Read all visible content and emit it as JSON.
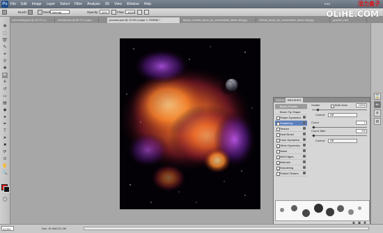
{
  "menubar": {
    "logo": "Ps",
    "items": [
      "File",
      "Edit",
      "Image",
      "Layer",
      "Select",
      "Filter",
      "Analysis",
      "3D",
      "View",
      "Window",
      "Help"
    ],
    "workspace": "ESS",
    "watermark_cn": "活力盒子"
  },
  "options": {
    "brush_label": "Brush:",
    "mode_label": "Mode:",
    "mode_value": "Normal",
    "opacity_label": "Opacity:",
    "opacity_value": "20%",
    "flow_label": "Flow:",
    "flow_value": "100%",
    "watermark": "OLiHE.COM"
  },
  "tabs": [
    {
      "label": "community.psd @ 16.7% (L...",
      "active": false
    },
    {
      "label": "tutorial.psd @ 66.7% (Laye...",
      "active": false
    },
    {
      "label": "process.psd @ 12.5% (Layer 1, RGB/8) *",
      "active": true
    },
    {
      "label": "flaque_nebula_stock_by_moonchilde_stock.d2a.jpg",
      "active": false
    },
    {
      "label": "nebula_stock_by_moonchilde_stock.d3a.jpg",
      "active": false
    },
    {
      "label": "pplanet_neb",
      "active": false
    }
  ],
  "brushes_panel": {
    "tabs": [
      "PATHS",
      "BRUSHES"
    ],
    "rows": [
      {
        "label": "Brush Presets",
        "kind": "header",
        "checked": false
      },
      {
        "label": "Brush Tip Shape",
        "kind": "plain",
        "checked": false
      },
      {
        "label": "Shape Dynamics",
        "kind": "check",
        "checked": false
      },
      {
        "label": "Scattering",
        "kind": "check",
        "checked": true,
        "selected": true
      },
      {
        "label": "Texture",
        "kind": "check",
        "checked": false
      },
      {
        "label": "Dual Brush",
        "kind": "check",
        "checked": false
      },
      {
        "label": "Color Dynamics",
        "kind": "check",
        "checked": false
      },
      {
        "label": "Other Dynamics",
        "kind": "check",
        "checked": true
      },
      {
        "label": "Noise",
        "kind": "check",
        "checked": false
      },
      {
        "label": "Wet Edges",
        "kind": "check",
        "checked": false
      },
      {
        "label": "Airbrush",
        "kind": "check",
        "checked": true
      },
      {
        "label": "Smoothing",
        "kind": "check",
        "checked": true
      },
      {
        "label": "Protect Texture",
        "kind": "check",
        "checked": false
      }
    ],
    "scatter_label": "Scatter",
    "both_axes_label": "Both Axes",
    "scatter_value": "120%",
    "control_label": "Control:",
    "control_value": "Off",
    "count_label": "Count",
    "count_value": "1",
    "count_jitter_label": "Count Jitter",
    "count_jitter_value": "0%",
    "control2_label": "Control:",
    "control2_value": "Off"
  },
  "status": {
    "zoom": "12.5%",
    "doc": "Doc: 91.9M/131.2M"
  }
}
